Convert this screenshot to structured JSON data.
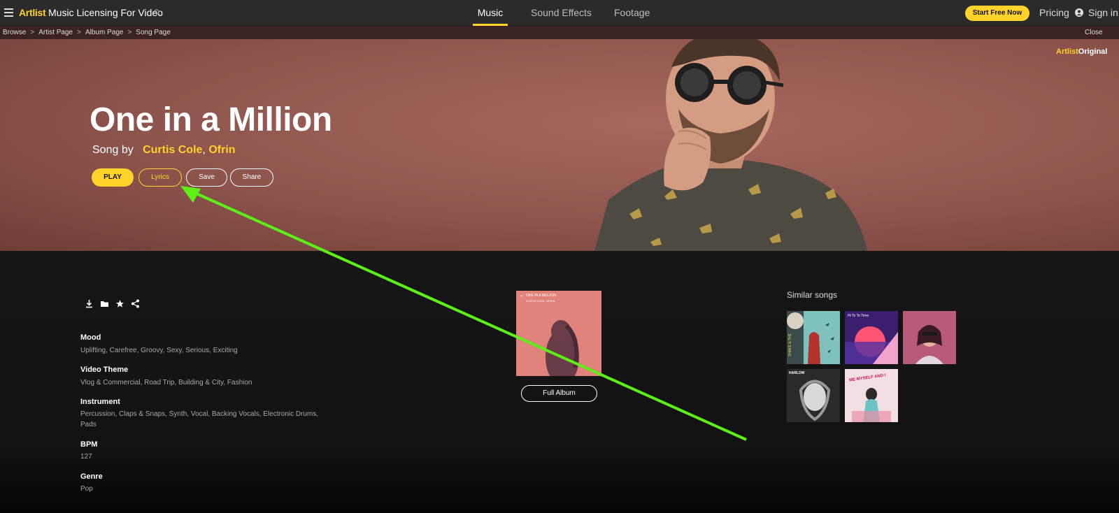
{
  "nav": {
    "logo": "Artlist",
    "site_title": "Music Licensing For Video",
    "tabs": [
      {
        "label": "Music",
        "active": true
      },
      {
        "label": "Sound Effects",
        "active": false
      },
      {
        "label": "Footage",
        "active": false
      }
    ],
    "start_button": "Start Free Now",
    "pricing": "Pricing",
    "signin": "Sign in"
  },
  "breadcrumb": {
    "items": [
      "Browse",
      "Artist Page",
      "Album Page",
      "Song Page"
    ],
    "separator": ">",
    "close": "Close"
  },
  "hero": {
    "badge_brand": "Artlist",
    "badge_suffix": "Original",
    "title": "One in a Million",
    "song_by_prefix": "Song by",
    "artists": [
      "Curtis Cole",
      "Ofrin"
    ],
    "artist_separator": ",",
    "buttons": {
      "play": "PLAY",
      "lyrics": "Lyrics",
      "save": "Save",
      "share": "Share"
    }
  },
  "details": {
    "action_icons": [
      "download-icon",
      "folder-icon",
      "star-icon",
      "share-icon"
    ],
    "fields": [
      {
        "label": "Mood",
        "value": "Uplifting, Carefree, Groovy, Sexy, Serious, Exciting"
      },
      {
        "label": "Video Theme",
        "value": "Vlog & Commercial, Road Trip, Building & City, Fashion"
      },
      {
        "label": "Instrument",
        "value": "Percussion, Claps & Snaps, Synth, Vocal, Backing Vocals, Electronic Drums, Pads"
      },
      {
        "label": "BPM",
        "value": "127"
      },
      {
        "label": "Genre",
        "value": "Pop"
      }
    ]
  },
  "album": {
    "cover_title": "ONE IN A MILLION",
    "cover_artists": "CURTIS COLE, OFRIN",
    "full_album": "Full Album"
  },
  "similar": {
    "title": "Similar songs",
    "covers": [
      {
        "text": "SHAKE & THE"
      },
      {
        "text": "Hi To To Time"
      },
      {
        "text": ""
      },
      {
        "text": "HARLOW"
      },
      {
        "text": "ME MYSELF AND I"
      }
    ]
  },
  "colors": {
    "accent": "#ffd32a",
    "annotation": "#5cf016"
  }
}
